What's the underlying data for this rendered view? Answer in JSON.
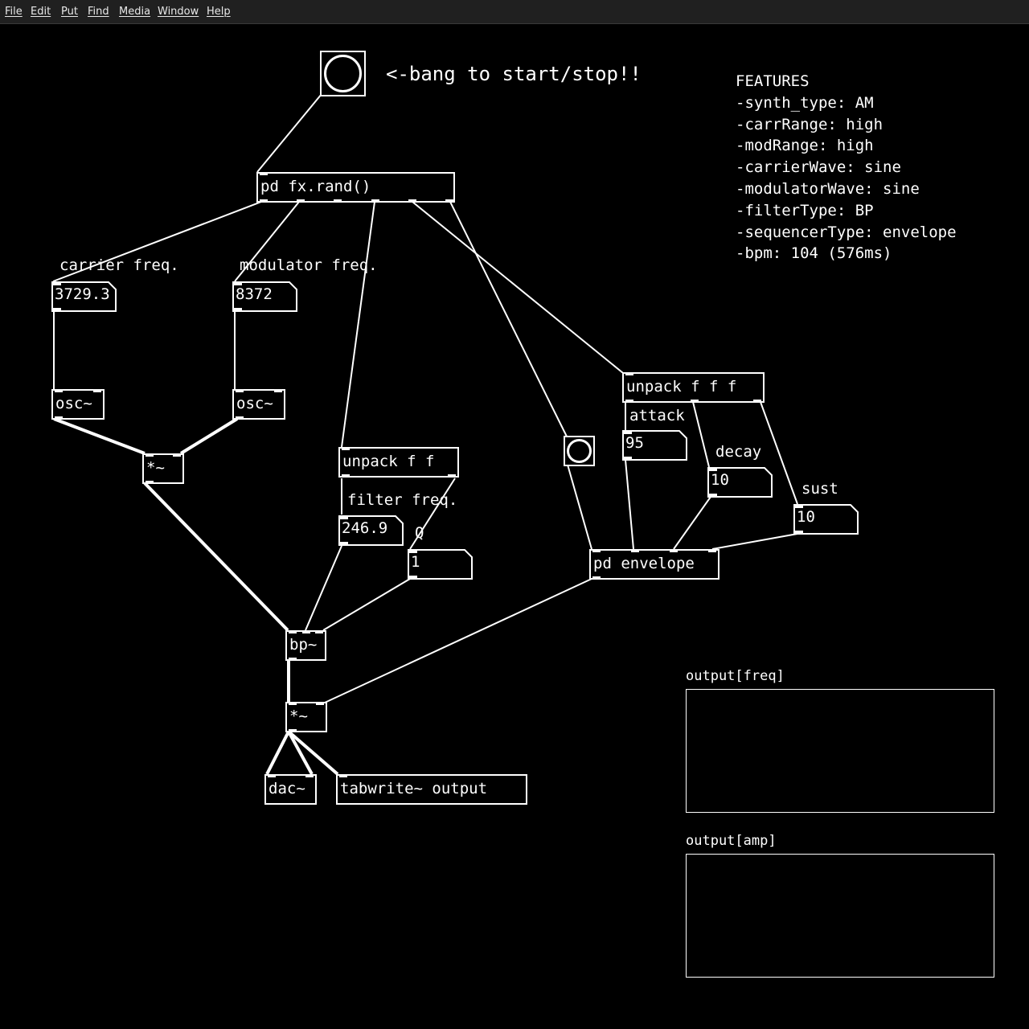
{
  "menu": [
    "File",
    "Edit",
    "Put",
    "Find",
    "Media",
    "Window",
    "Help"
  ],
  "patch": {
    "start_comment": "<-bang to start/stop!!",
    "objects": {
      "fx_rand": "pd   fx.rand()",
      "osc_carrier": "osc~",
      "osc_modulator": "osc~",
      "mult_am": "*~",
      "unpack_filter": "unpack f f",
      "unpack_env": "unpack f f f",
      "bp": "bp~",
      "mult_env": "*~",
      "dac": "dac~",
      "tabwrite": "tabwrite~ output",
      "pd_envelope": "pd envelope"
    },
    "numbers": {
      "carrier_freq": {
        "label": "carrier freq.",
        "value": "3729.3"
      },
      "modulator_freq": {
        "label": "modulator freq.",
        "value": "8372"
      },
      "filter_freq": {
        "label": "filter freq.",
        "value": "246.9"
      },
      "q": {
        "label": "Q",
        "value": "1"
      },
      "attack": {
        "label": "attack",
        "value": "95"
      },
      "decay": {
        "label": "decay",
        "value": "10"
      },
      "sust": {
        "label": "sust",
        "value": "10"
      }
    },
    "features": [
      "FEATURES",
      "-synth_type: AM",
      "-carrRange: high",
      "-modRange: high",
      "-carrierWave: sine",
      "-modulatorWave: sine",
      "-filterType: BP",
      "-sequencerType: envelope",
      "-bpm: 104 (576ms)"
    ],
    "arrays": {
      "freq": "output[freq]",
      "amp": "output[amp]"
    }
  }
}
